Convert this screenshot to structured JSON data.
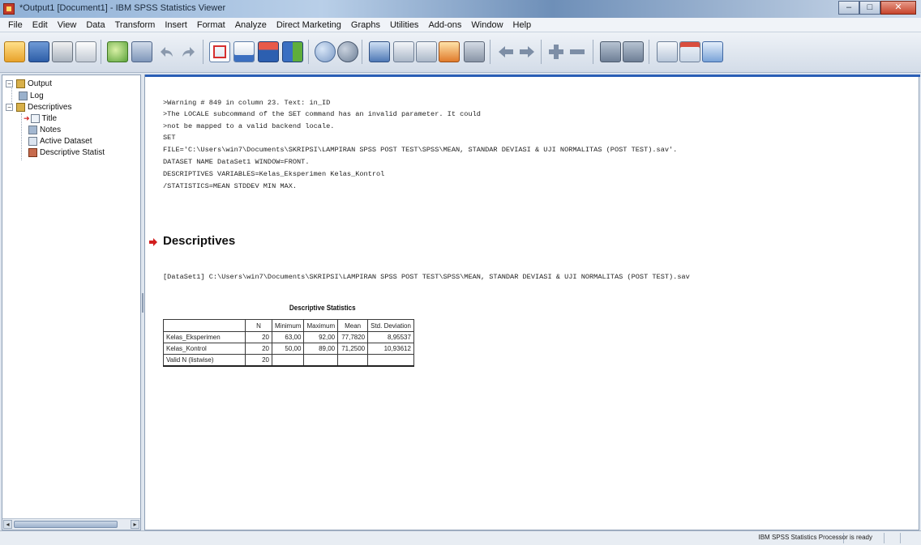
{
  "window": {
    "title": "*Output1 [Document1] - IBM SPSS Statistics Viewer",
    "controls": [
      "–",
      "□",
      "✕"
    ]
  },
  "menu": [
    "File",
    "Edit",
    "View",
    "Data",
    "Transform",
    "Insert",
    "Format",
    "Analyze",
    "Direct Marketing",
    "Graphs",
    "Utilities",
    "Add-ons",
    "Window",
    "Help"
  ],
  "toolbar": {
    "icons": [
      "open-folder-icon",
      "save-icon",
      "print-icon",
      "print-preview-icon",
      "export-icon",
      "recall-dialog-icon",
      "undo-icon",
      "redo-icon",
      "goto-case-icon",
      "goto-variable-icon",
      "variables-icon",
      "data-editor-icon",
      "designate-window-icon",
      "select-last-output-icon",
      "run-script-icon",
      "insert-heading-icon",
      "insert-title-icon",
      "insert-text-icon",
      "create-title-icon",
      "hide-icon",
      "promote-icon",
      "demote-icon",
      "expand-icon",
      "collapse-icon",
      "show-icon",
      "hide-all-icon",
      "page-setup-icon",
      "copy-icon",
      "paste-icon"
    ]
  },
  "outline": {
    "root": "Output",
    "log": "Log",
    "descriptives": "Descriptives",
    "title": "Title",
    "notes": "Notes",
    "active_dataset": "Active Dataset",
    "descriptive_statistics": "Descriptive Statist"
  },
  "log": [
    ">Warning # 849 in column 23.  Text: in_ID",
    ">The LOCALE subcommand of the SET command has an invalid parameter.  It could",
    ">not be mapped to a valid backend locale.",
    "SET",
    "  FILE='C:\\Users\\win7\\Documents\\SKRIPSI\\LAMPIRAN SPSS POST TEST\\SPSS\\MEAN, STANDAR DEVIASI & UJI NORMALITAS (POST TEST).sav'.",
    "DATASET NAME DataSet1 WINDOW=FRONT.",
    "DESCRIPTIVES VARIABLES=Kelas_Eksperimen Kelas_Kontrol",
    "  /STATISTICS=MEAN STDDEV MIN MAX."
  ],
  "section": {
    "title": "Descriptives",
    "dataset_line": "[DataSet1] C:\\Users\\win7\\Documents\\SKRIPSI\\LAMPIRAN SPSS POST TEST\\SPSS\\MEAN, STANDAR DEVIASI & UJI NORMALITAS (POST TEST).sav"
  },
  "table": {
    "title": "Descriptive Statistics",
    "headers": [
      "",
      "N",
      "Minimum",
      "Maximum",
      "Mean",
      "Std. Deviation"
    ],
    "rows": [
      [
        "Kelas_Eksperimen",
        "20",
        "63,00",
        "92,00",
        "77,7820",
        "8,95537"
      ],
      [
        "Kelas_Kontrol",
        "20",
        "50,00",
        "89,00",
        "71,2500",
        "10,93612"
      ],
      [
        "Valid N (listwise)",
        "20",
        "",
        "",
        "",
        ""
      ]
    ]
  },
  "status": {
    "text": "IBM SPSS Statistics Processor is ready"
  },
  "colors": {
    "accent": "#2a5eb6",
    "section_arrow": "#d21e1e"
  }
}
